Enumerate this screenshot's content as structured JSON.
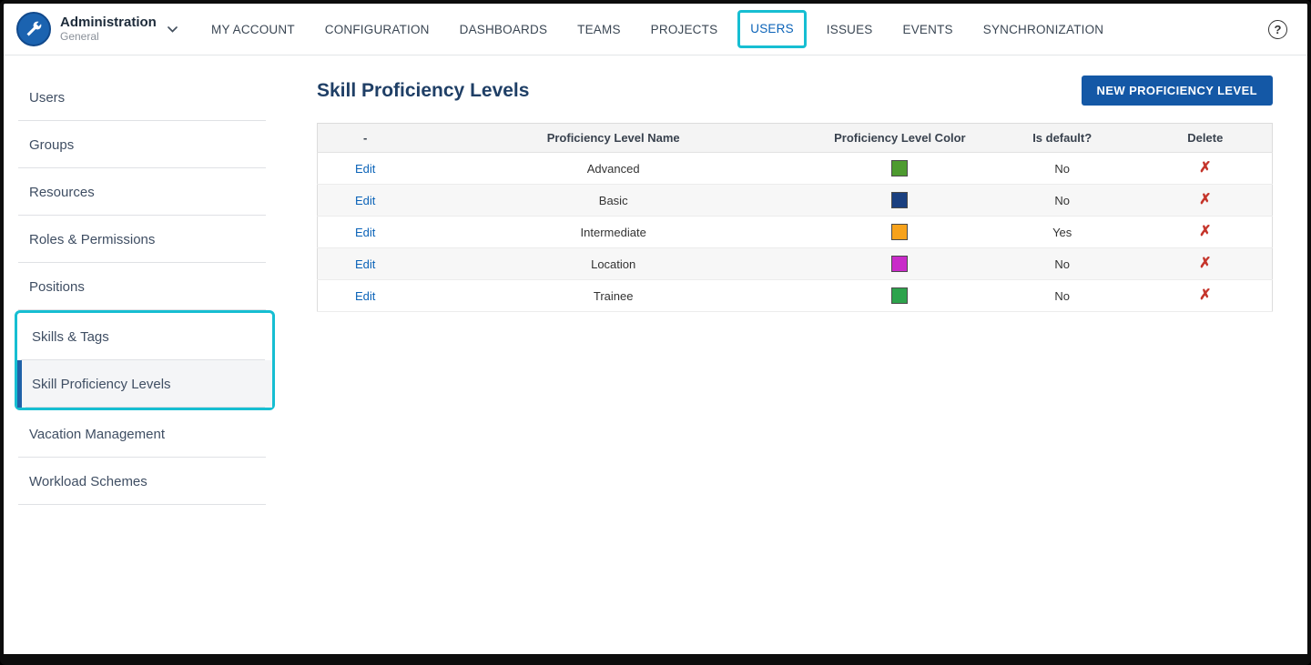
{
  "icons": {
    "help_glyph": "?",
    "delete_glyph": "✗"
  },
  "header": {
    "app_title": "Administration",
    "app_subtitle": "General",
    "nav": [
      {
        "label": "MY ACCOUNT"
      },
      {
        "label": "CONFIGURATION"
      },
      {
        "label": "DASHBOARDS"
      },
      {
        "label": "TEAMS"
      },
      {
        "label": "PROJECTS"
      },
      {
        "label": "USERS"
      },
      {
        "label": "ISSUES"
      },
      {
        "label": "EVENTS"
      },
      {
        "label": "SYNCHRONIZATION"
      }
    ]
  },
  "sidebar": {
    "items": [
      {
        "label": "Users"
      },
      {
        "label": "Groups"
      },
      {
        "label": "Resources"
      },
      {
        "label": "Roles & Permissions"
      },
      {
        "label": "Positions"
      },
      {
        "label": "Skills & Tags"
      },
      {
        "label": "Skill Proficiency Levels"
      },
      {
        "label": "Vacation Management"
      },
      {
        "label": "Workload Schemes"
      }
    ]
  },
  "main": {
    "title": "Skill Proficiency Levels",
    "new_button_label": "NEW PROFICIENCY LEVEL",
    "table": {
      "columns": [
        "-",
        "Proficiency Level Name",
        "Proficiency Level Color",
        "Is default?",
        "Delete"
      ],
      "edit_label": "Edit",
      "rows": [
        {
          "name": "Advanced",
          "color": "#4e9b30",
          "is_default": "No"
        },
        {
          "name": "Basic",
          "color": "#1b4080",
          "is_default": "No"
        },
        {
          "name": "Intermediate",
          "color": "#f7a21b",
          "is_default": "Yes"
        },
        {
          "name": "Location",
          "color": "#c92bc9",
          "is_default": "No"
        },
        {
          "name": "Trainee",
          "color": "#2da34c",
          "is_default": "No"
        }
      ]
    }
  },
  "colors": {
    "accent_blue": "#1458a6",
    "link_blue": "#0b63b8",
    "highlight_cyan": "#16bed2",
    "delete_red": "#c5352b"
  }
}
